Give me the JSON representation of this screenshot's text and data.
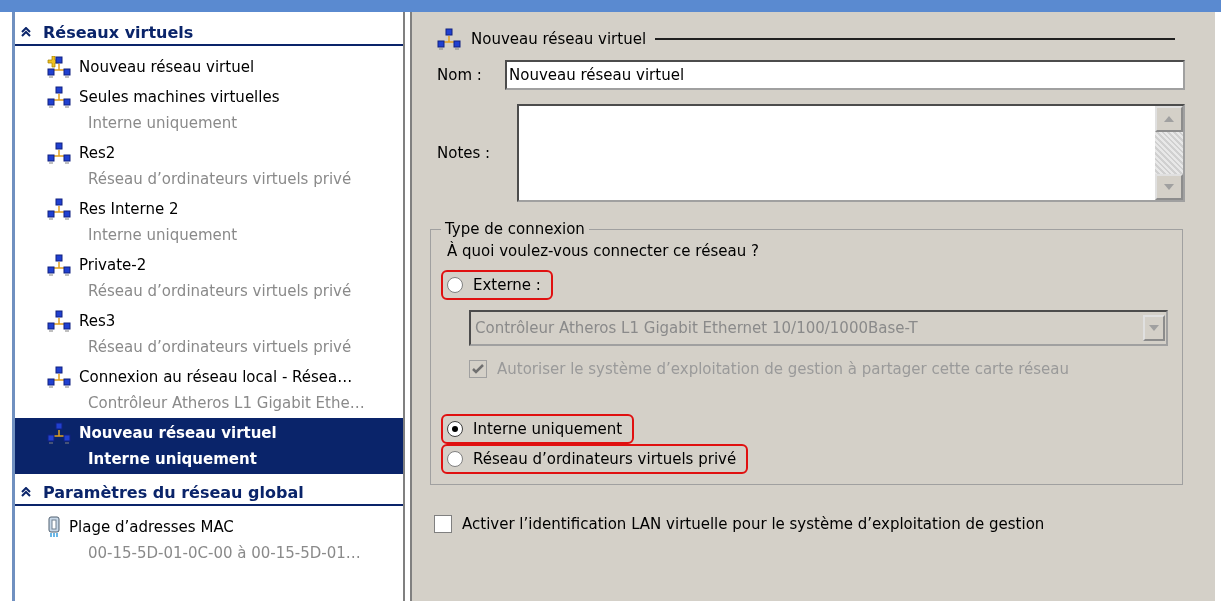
{
  "sidebar": {
    "sections": [
      {
        "title": "Réseaux virtuels",
        "expanded": true,
        "items": [
          {
            "kind": "new",
            "name": "Nouveau réseau virtuel",
            "selected": false
          },
          {
            "kind": "network",
            "name": "Seules machines virtuelles",
            "detail": "Interne uniquement",
            "selected": false
          },
          {
            "kind": "network",
            "name": "Res2",
            "detail": "Réseau d’ordinateurs virtuels privé",
            "selected": false
          },
          {
            "kind": "network",
            "name": "Res Interne 2",
            "detail": "Interne uniquement",
            "selected": false
          },
          {
            "kind": "network",
            "name": "Private-2",
            "detail": "Réseau d’ordinateurs virtuels privé",
            "selected": false
          },
          {
            "kind": "network",
            "name": "Res3",
            "detail": "Réseau d’ordinateurs virtuels privé",
            "selected": false
          },
          {
            "kind": "network",
            "name": "Connexion au réseau local - Résea…",
            "detail": "Contrôleur Atheros L1 Gigabit Ethe…",
            "selected": false
          },
          {
            "kind": "network",
            "name": "Nouveau réseau virtuel",
            "detail": "Interne uniquement",
            "selected": true
          }
        ]
      },
      {
        "title": "Paramètres du réseau global",
        "expanded": true,
        "items": [
          {
            "kind": "mac",
            "name": "Plage d’adresses MAC",
            "detail": "00-15-5D-01-0C-00 à 00-15-5D-01…",
            "selected": false
          }
        ]
      }
    ]
  },
  "panel": {
    "title": "Nouveau réseau virtuel",
    "name_label": "Nom :",
    "name_value": "Nouveau réseau virtuel",
    "notes_label": "Notes :",
    "connection_type": {
      "legend": "Type de connexion",
      "question": "À quoi voulez-vous connecter ce réseau ?",
      "options": [
        {
          "kind": "external",
          "label": "Externe :",
          "selected": false,
          "highlighted": true
        },
        {
          "kind": "internal",
          "label": "Interne uniquement",
          "selected": true,
          "highlighted": true
        },
        {
          "kind": "private",
          "label": "Réseau d’ordinateurs virtuels privé",
          "selected": false,
          "highlighted": true
        }
      ],
      "adapter": {
        "value": "Contrôleur Atheros L1 Gigabit Ethernet 10/100/1000Base-T",
        "disabled": true
      },
      "share": {
        "label": "Autoriser le système d’exploitation de gestion à partager cette carte réseau",
        "checked": true,
        "disabled": true
      }
    },
    "vlan": {
      "label": "Activer l’identification LAN virtuelle pour le système d’exploitation de gestion",
      "checked": false
    }
  }
}
